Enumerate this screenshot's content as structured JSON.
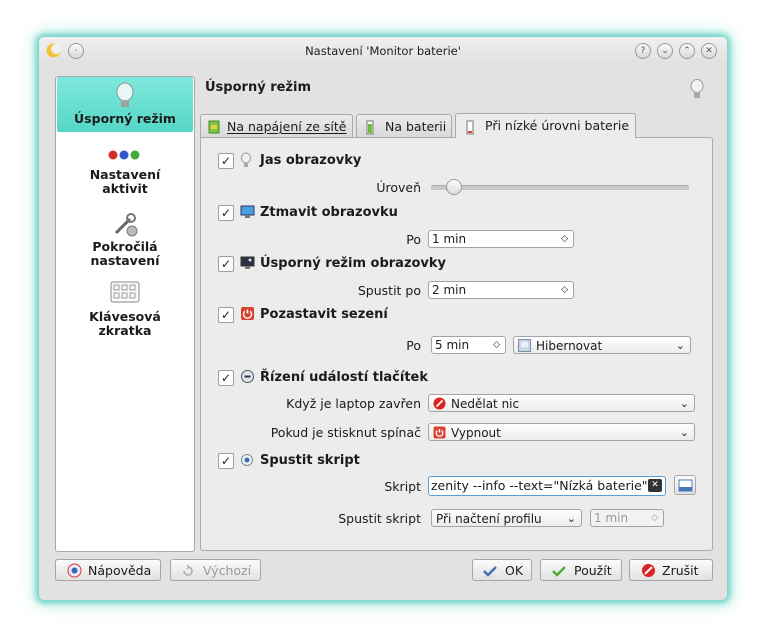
{
  "window": {
    "title": "Nastavení 'Monitor baterie'"
  },
  "sidebar": {
    "items": [
      {
        "label": "Úsporný režim"
      },
      {
        "label": "Nastavení aktivit"
      },
      {
        "label": "Pokročilá nastavení"
      },
      {
        "label": "Klávesová zkratka"
      }
    ]
  },
  "header": {
    "title": "Úsporný režim"
  },
  "tabs": [
    {
      "label": "Na napájení ze sítě"
    },
    {
      "label": "Na baterii"
    },
    {
      "label": "Při nízké úrovni baterie"
    }
  ],
  "screen_brightness": {
    "checked": true,
    "label": "Jas obrazovky",
    "level_label": "Úroveň",
    "level": 0.06
  },
  "dim_screen": {
    "checked": true,
    "label": "Ztmavit obrazovku",
    "after_label": "Po",
    "after_value": "1 min"
  },
  "screen_saver": {
    "checked": true,
    "label": "Úsporný režim obrazovky",
    "start_label": "Spustit po",
    "start_value": "2 min"
  },
  "suspend": {
    "checked": true,
    "label": "Pozastavit sezení",
    "after_label": "Po",
    "after_value": "5 min",
    "method": "Hibernovat"
  },
  "button_events": {
    "checked": true,
    "label": "Řízení událostí tlačítek",
    "lid_label": "Když je laptop zavřen",
    "lid_value": "Nedělat nic",
    "power_label": "Pokud je stisknut spínač",
    "power_value": "Vypnout"
  },
  "run_script": {
    "checked": true,
    "label": "Spustit skript",
    "script_label": "Skript",
    "script_value": "zenity --info --text=\"Nízká baterie\"",
    "when_label": "Spustit skript",
    "when_value": "Při načtení profilu",
    "delay_value": "1 min"
  },
  "buttons": {
    "help": "Nápověda",
    "defaults": "Výchozí",
    "ok": "OK",
    "apply": "Použít",
    "cancel": "Zrušit"
  },
  "colors": {
    "accent": "#55d6c6",
    "glow": "#6fd3c6"
  }
}
